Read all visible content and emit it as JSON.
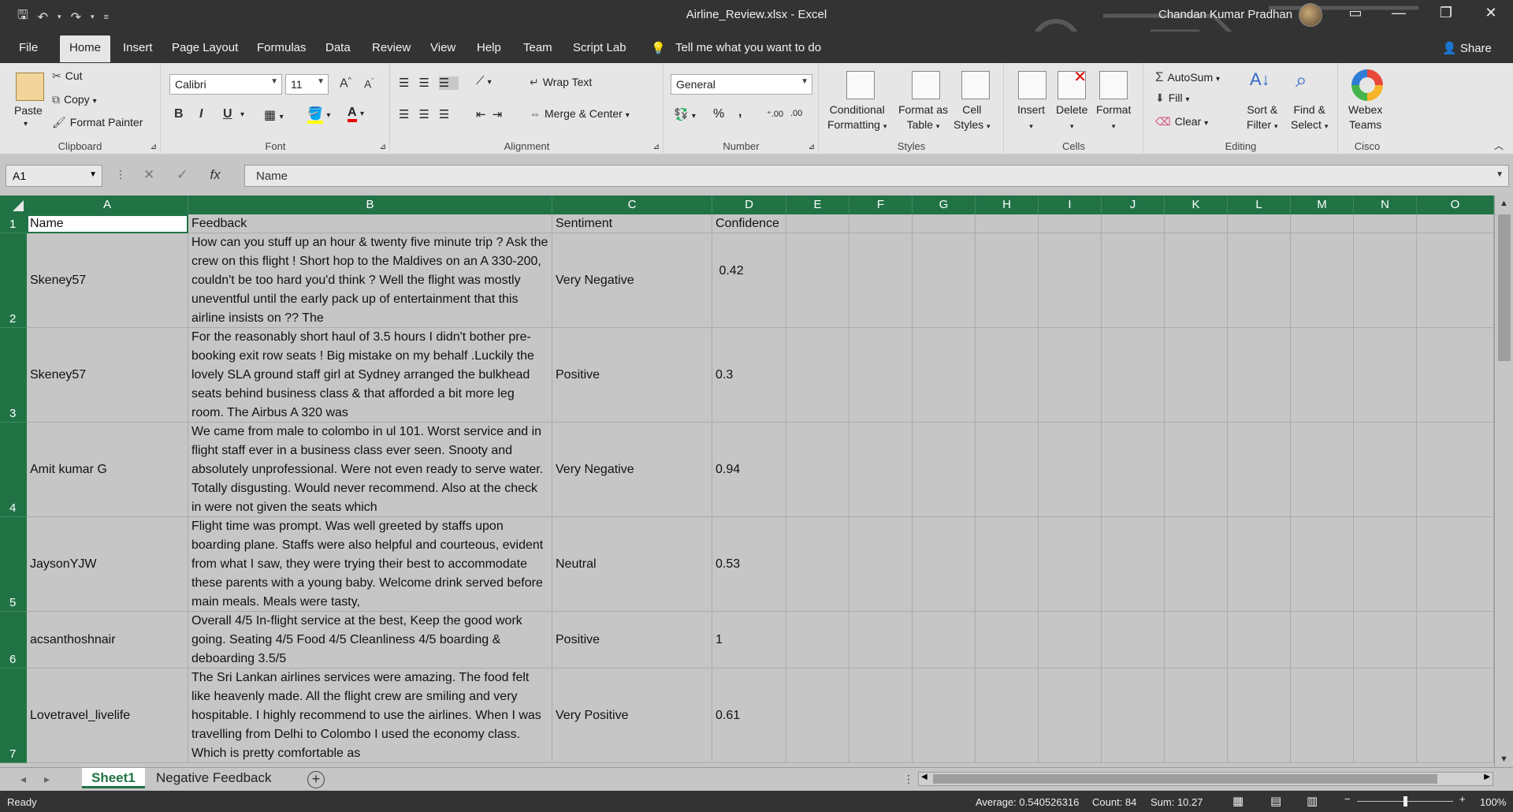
{
  "window": {
    "title": "Airline_Review.xlsx  -  Excel",
    "user": "Chandan Kumar Pradhan"
  },
  "tabs": [
    "File",
    "Home",
    "Insert",
    "Page Layout",
    "Formulas",
    "Data",
    "Review",
    "View",
    "Help",
    "Team",
    "Script Lab"
  ],
  "tell_me": "Tell me what you want to do",
  "share": "Share",
  "ribbon": {
    "clipboard": {
      "paste": "Paste",
      "cut": "Cut",
      "copy": "Copy",
      "format_painter": "Format Painter",
      "label": "Clipboard"
    },
    "font": {
      "name": "Calibri",
      "size": "11",
      "label": "Font"
    },
    "alignment": {
      "wrap": "Wrap Text",
      "merge": "Merge & Center",
      "label": "Alignment"
    },
    "number": {
      "format": "General",
      "label": "Number"
    },
    "styles": {
      "conditional": "Conditional",
      "conditional2": "Formatting",
      "format_as": "Format as",
      "format_as2": "Table",
      "cell": "Cell",
      "cell2": "Styles",
      "label": "Styles"
    },
    "cells": {
      "insert": "Insert",
      "delete": "Delete",
      "format": "Format",
      "label": "Cells"
    },
    "editing": {
      "autosum": "AutoSum",
      "fill": "Fill",
      "clear": "Clear",
      "sort": "Sort &",
      "sort2": "Filter",
      "find": "Find &",
      "find2": "Select",
      "label": "Editing"
    },
    "cisco": {
      "webex": "Webex",
      "webex2": "Teams",
      "label": "Cisco"
    }
  },
  "formula_bar": {
    "name_box": "A1",
    "content": "Name"
  },
  "columns": [
    "A",
    "B",
    "C",
    "D",
    "E",
    "F",
    "G",
    "H",
    "I",
    "J",
    "K",
    "L",
    "M",
    "N",
    "O"
  ],
  "header_row": {
    "row": "1",
    "a": "Name",
    "b": "Feedback",
    "c": "Sentiment",
    "d": "Confidence"
  },
  "rows": [
    {
      "row": "2",
      "name": "Skeney57",
      "feedback": "How can you stuff up an hour & twenty five minute trip ? Ask the crew on this flight ! Short hop to the Maldives on an A 330-200, couldn't be too hard you'd think ? Well the flight was mostly uneventful until the early pack up of entertainment that this airline insists on ?? The",
      "sentiment": "Very Negative",
      "confidence": " 0.42"
    },
    {
      "row": "3",
      "name": "Skeney57",
      "feedback": "For the reasonably short haul of 3.5 hours I didn't bother pre-booking exit row seats ! Big mistake on my behalf .Luckily the lovely SLA ground staff girl at Sydney arranged the bulkhead seats behind business class & that afforded a bit more leg room. The Airbus A 320 was",
      "sentiment": "Positive",
      "confidence": "0.3"
    },
    {
      "row": "4",
      "name": "Amit kumar G",
      "feedback": "We came from male to colombo in ul 101. Worst service and in flight staff ever in a business class ever seen. Snooty and absolutely unprofessional. Were not even ready to serve water. Totally disgusting. Would never recommend. Also at the check in were not given the seats which",
      "sentiment": "Very Negative",
      "confidence": "0.94"
    },
    {
      "row": "5",
      "name": "JaysonYJW",
      "feedback": "Flight time was prompt. Was well greeted by staffs upon boarding plane. Staffs were also helpful and courteous, evident from what I saw, they were trying their best to accommodate these parents with a young baby. Welcome drink served before main meals. Meals were tasty,",
      "sentiment": "Neutral",
      "confidence": "0.53"
    },
    {
      "row": "6",
      "name": "acsanthoshnair",
      "feedback": "Overall 4/5 In-flight service at the best, Keep the good work going. Seating 4/5 Food 4/5 Cleanliness 4/5 boarding & deboarding 3.5/5",
      "sentiment": "Positive",
      "confidence": "1"
    },
    {
      "row": "7",
      "name": "Lovetravel_livelife",
      "feedback": "The Sri Lankan airlines services were amazing. The food felt like heavenly made. All the flight crew are smiling and very hospitable. I highly recommend to use the airlines. When I was travelling from Delhi to Colombo I used the economy class. Which is pretty comfortable as",
      "sentiment": "Very Positive",
      "confidence": "0.61"
    }
  ],
  "sheets": [
    "Sheet1",
    "Negative Feedback"
  ],
  "status": {
    "ready": "Ready",
    "average": "Average: 0.540526316",
    "count": "Count: 84",
    "sum": "Sum: 10.27",
    "zoom": "100%"
  },
  "colors": {
    "accent": "#217346",
    "chrome": "#333333",
    "cells": "#c6c6c6"
  }
}
